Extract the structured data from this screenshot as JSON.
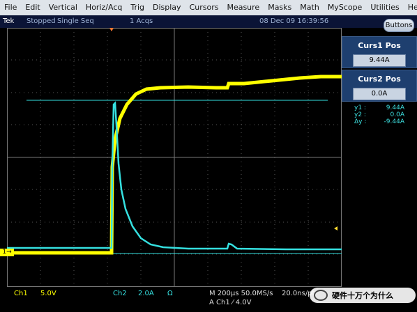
{
  "menu": [
    "File",
    "Edit",
    "Vertical",
    "Horiz/Acq",
    "Trig",
    "Display",
    "Cursors",
    "Measure",
    "Masks",
    "Math",
    "MyScope",
    "Utilities",
    "Help"
  ],
  "status": {
    "brand": "Tek",
    "state": "Stopped",
    "mode": "Single Seq",
    "acqs": "1 Acqs",
    "datetime": "08 Dec 09 16:39:56"
  },
  "buttons_label": "Buttons",
  "cursor1": {
    "title": "Curs1 Pos",
    "value": "9.44A"
  },
  "cursor2": {
    "title": "Curs2 Pos",
    "value": "0.0A"
  },
  "readout": {
    "y1_label": "y1 :",
    "y1_value": "9.44A",
    "y2_label": "y2 :",
    "y2_value": "0.0A",
    "dy_label": "Δy :",
    "dy_value": "-9.44A"
  },
  "channel_marker": "1→",
  "bottom": {
    "ch1_label": "Ch1",
    "ch1_scale": "5.0V",
    "ch2_label": "Ch2",
    "ch2_scale": "2.0A",
    "ch2_coupling": "Ω",
    "horiz": "M 200µs 50.0MS/s",
    "resolution": "20.0ns/pt",
    "trigger": "A  Ch1  ⁄  4.0V"
  },
  "watermark": "硬件十万个为什么",
  "colors": {
    "ch1": "#ffff00",
    "ch2": "#35e0e0",
    "background": "#000000",
    "panel": "#1e3f6f"
  }
}
